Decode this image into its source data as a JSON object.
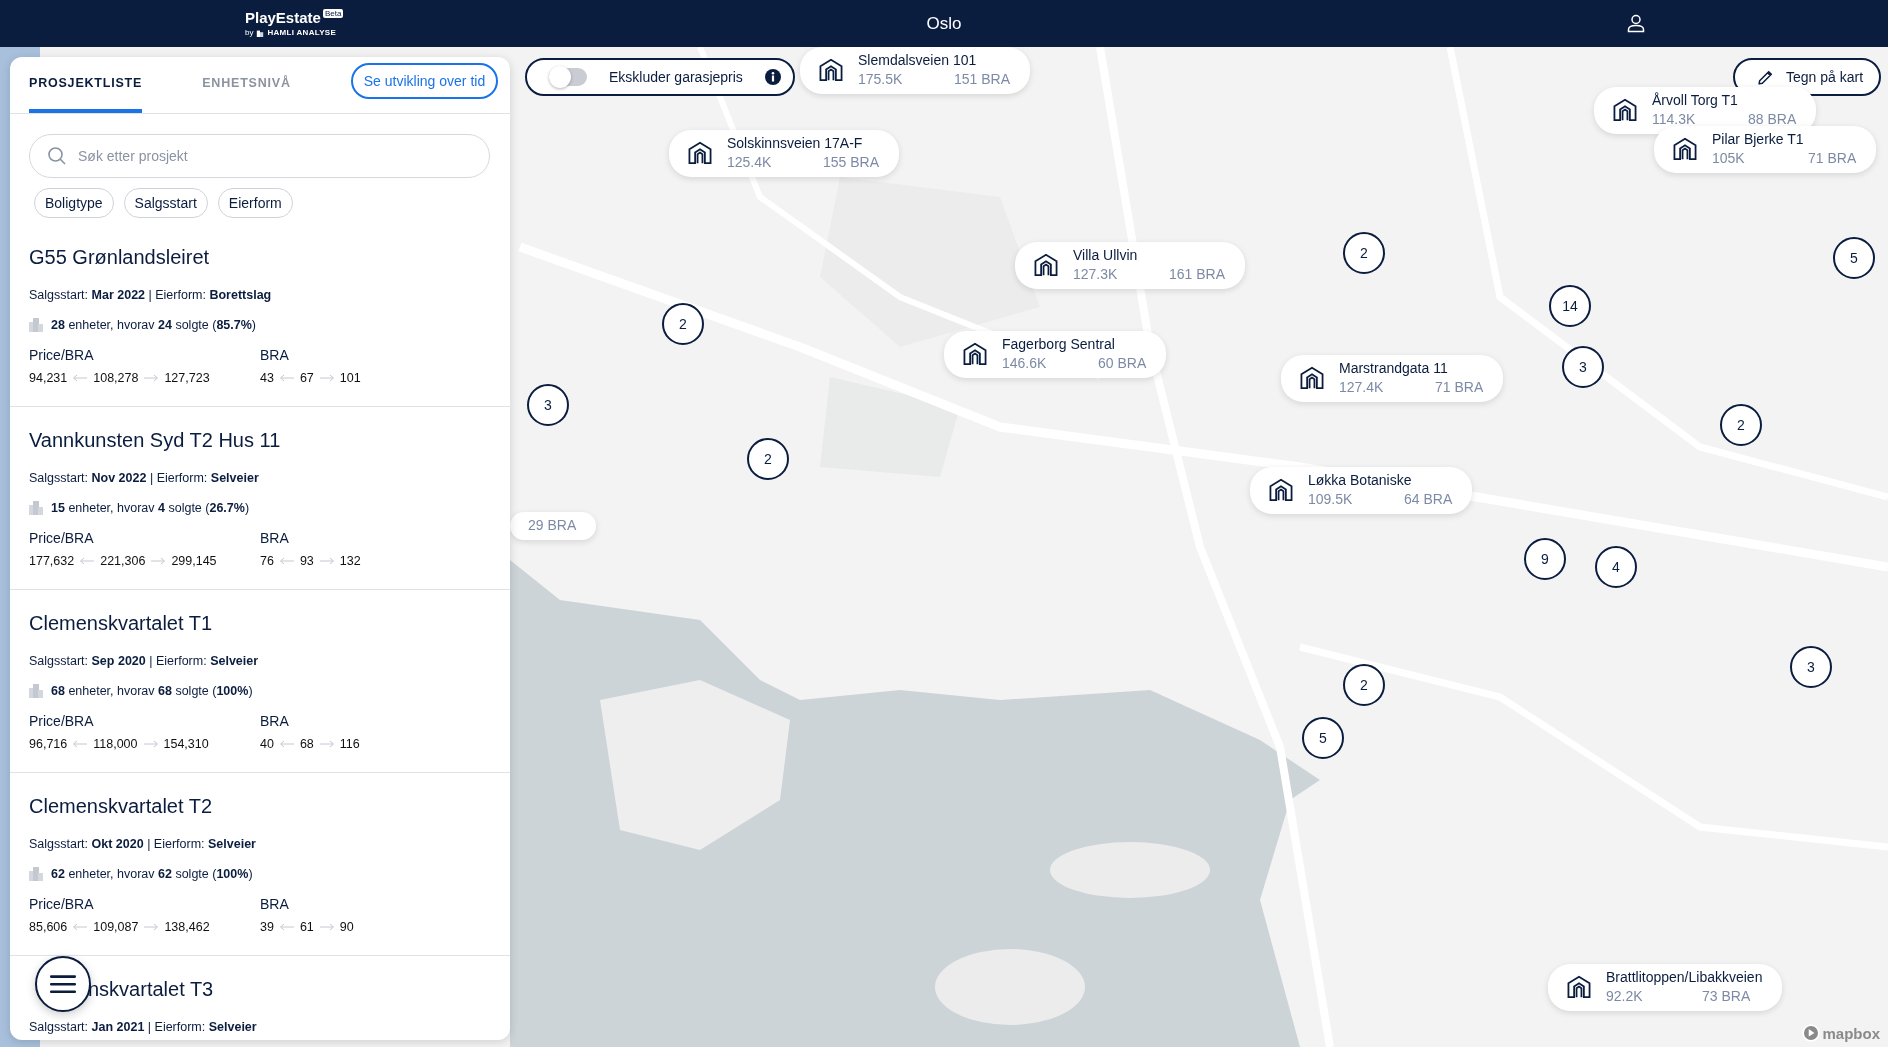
{
  "header": {
    "logo": {
      "name": "PlayEstate",
      "badge": "Beta",
      "byline": "by",
      "company": "HAMLI ANALYSE"
    },
    "title": "Oslo"
  },
  "sidebar": {
    "tabs": [
      {
        "label": "PROSJEKTLISTE",
        "selected": true
      },
      {
        "label": "ENHETSNIVÅ",
        "selected": false
      }
    ],
    "action_button": "Se utvikling over tid",
    "search": {
      "placeholder": "Søk etter prosjekt"
    },
    "filters": [
      "Boligtype",
      "Salgsstart",
      "Eierform"
    ],
    "projects": [
      {
        "name": "G55 Grønlandsleiret",
        "meta": "Salgsstart: **Mar 2022** | Eierform: **Borettslag**",
        "units": "**28** enheter, hvorav **24** solgte (**85.7%**)",
        "price_label": "Price/BRA",
        "price": [
          "94,231",
          "108,278",
          "127,723"
        ],
        "area_label": "BRA",
        "area": [
          "43",
          "67",
          "101"
        ]
      },
      {
        "name": "Vannkunsten Syd T2 Hus 11",
        "meta": "Salgsstart: **Nov 2022** | Eierform: **Selveier**",
        "units": "**15** enheter, hvorav **4** solgte (**26.7%**)",
        "price_label": "Price/BRA",
        "price": [
          "177,632",
          "221,306",
          "299,145"
        ],
        "area_label": "BRA",
        "area": [
          "76",
          "93",
          "132"
        ]
      },
      {
        "name": "Clemenskvartalet T1",
        "meta": "Salgsstart: **Sep 2020** | Eierform: **Selveier**",
        "units": "**68** enheter, hvorav **68** solgte (**100%**)",
        "price_label": "Price/BRA",
        "price": [
          "96,716",
          "118,000",
          "154,310"
        ],
        "area_label": "BRA",
        "area": [
          "40",
          "68",
          "116"
        ]
      },
      {
        "name": "Clemenskvartalet T2",
        "meta": "Salgsstart: **Okt 2020** | Eierform: **Selveier**",
        "units": "**62** enheter, hvorav **62** solgte (**100%**)",
        "price_label": "Price/BRA",
        "price": [
          "85,606",
          "109,087",
          "138,462"
        ],
        "area_label": "BRA",
        "area": [
          "39",
          "61",
          "90"
        ]
      },
      {
        "name": "nskvartalet T3",
        "meta": "Salgsstart: **Jan 2021** | Eierform: **Selveier**"
      }
    ]
  },
  "map": {
    "toggle": {
      "label": "Ekskluder garasjepris",
      "on": false
    },
    "draw_button": "Tegn på kart",
    "markers": [
      {
        "name": "Slemdalsveien 101",
        "price": "175.5K",
        "area": "151 BRA"
      },
      {
        "name": "Solskinnsveien 17A-F",
        "price": "125.4K",
        "area": "155 BRA"
      },
      {
        "name": "Villa Ullvin",
        "price": "127.3K",
        "area": "161 BRA"
      },
      {
        "name": "Fagerborg Sentral",
        "price": "146.6K",
        "area": "60 BRA"
      },
      {
        "name": "Marstrandgata 11",
        "price": "127.4K",
        "area": "71 BRA"
      },
      {
        "name": "Løkka Botaniske",
        "price": "109.5K",
        "area": "64 BRA"
      },
      {
        "name": "Årvoll Torg T1",
        "price": "114.3K",
        "area": "88 BRA"
      },
      {
        "name": "Pilar Bjerke T1",
        "price": "105K",
        "area": "71 BRA"
      },
      {
        "name": "Brattlitoppen/Libakkveien",
        "price": "92.2K",
        "area": "73 BRA"
      },
      {
        "area": "29 BRA"
      }
    ],
    "clusters": [
      "2",
      "3",
      "2",
      "2",
      "14",
      "3",
      "5",
      "2",
      "9",
      "4",
      "2",
      "5",
      "3"
    ],
    "attribution": "mapbox"
  }
}
